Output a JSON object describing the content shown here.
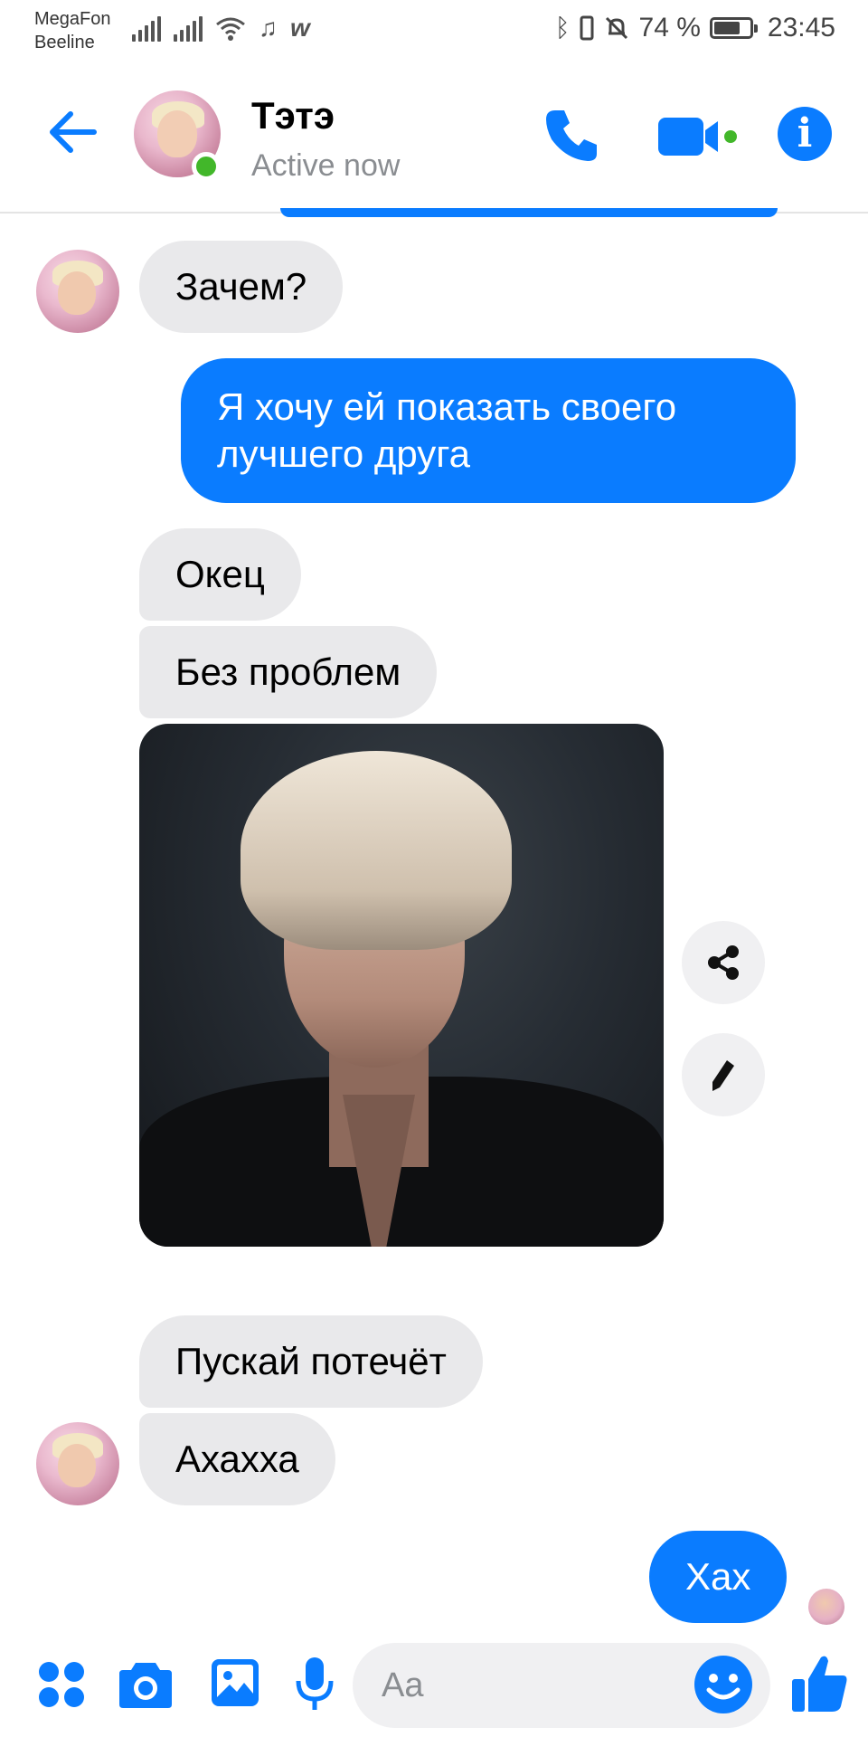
{
  "status_bar": {
    "carrier_1": "MegaFon",
    "carrier_2": "Beeline",
    "battery_percent": "74 %",
    "battery_level": 0.74,
    "time": "23:45"
  },
  "header": {
    "contact_name": "Тэтэ",
    "contact_status": "Active now",
    "icons": [
      "back-arrow-icon",
      "phone-icon",
      "video-camera-icon",
      "info-icon"
    ],
    "accent_color": "#0a7cff",
    "online_color": "#42b72a"
  },
  "messages": [
    {
      "from": "contact",
      "text": "Зачем?"
    },
    {
      "from": "me",
      "text_line1": "Я хочу ей показать своего",
      "text_line2": "лучшего друга"
    },
    {
      "from": "contact",
      "text": "Окец"
    },
    {
      "from": "contact",
      "text": "Без проблем"
    },
    {
      "from": "contact",
      "type": "photo"
    },
    {
      "from": "contact",
      "text": "Пускай потечёт"
    },
    {
      "from": "contact",
      "text": "Ахахха"
    },
    {
      "from": "me",
      "text": "Хах"
    }
  ],
  "photo_actions": [
    "share-icon",
    "edit-pencil-icon"
  ],
  "composer": {
    "placeholder": "Aa",
    "icons": [
      "apps-grid-icon",
      "camera-icon",
      "gallery-icon",
      "microphone-icon",
      "emoji-icon",
      "thumbs-up-icon"
    ]
  },
  "colors": {
    "incoming_bubble": "#e9e9eb",
    "outgoing_bubble": "#0a7cff",
    "muted_text": "#8a8d91"
  }
}
